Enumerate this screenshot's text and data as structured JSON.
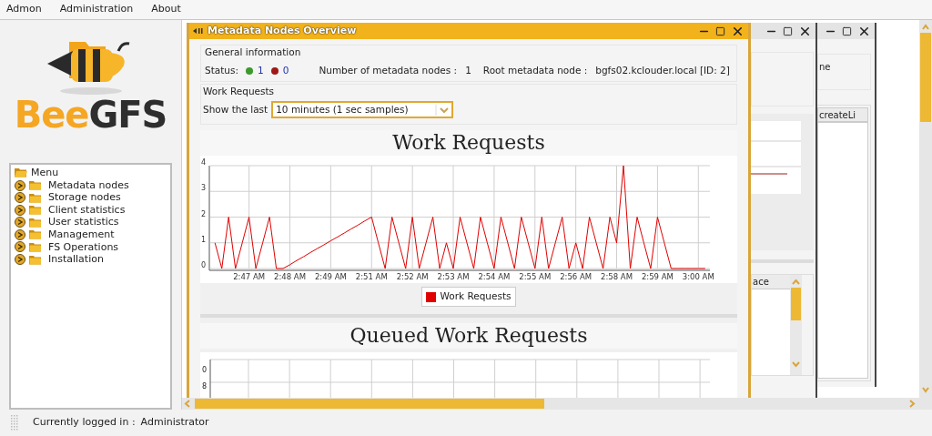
{
  "menu_bar": [
    "Admon",
    "Administration",
    "About"
  ],
  "logo": {
    "parts": [
      "Bee",
      "GFS"
    ]
  },
  "navigation_tree": {
    "label": "Menu",
    "expanded": true,
    "children": [
      {
        "label": "Metadata nodes",
        "expanded": false
      },
      {
        "label": "Storage nodes",
        "expanded": false
      },
      {
        "label": "Client statistics",
        "expanded": false
      },
      {
        "label": "User statistics",
        "expanded": false
      },
      {
        "label": "Management",
        "expanded": false
      },
      {
        "label": "FS Operations",
        "expanded": false
      },
      {
        "label": "Installation",
        "expanded": false
      }
    ]
  },
  "background_windows": [
    {
      "active": false,
      "label": "ne",
      "table_column": "createLi"
    },
    {
      "active": false,
      "table_column": "ace"
    }
  ],
  "main_window": {
    "title": "Metadata Nodes Overview",
    "active": true,
    "general_information": {
      "heading": "General information",
      "status_label": "Status:",
      "status_counts": [
        {
          "color": "#3c9a2c",
          "count": "1"
        },
        {
          "color": "#a01818",
          "count": "0"
        }
      ],
      "node_count_label": "Number of metadata nodes :",
      "node_count": "1",
      "root_label": "Root metadata node :",
      "root_value": "bgfs02.kclouder.local [ID: 2]"
    },
    "work_requests": {
      "heading": "Work Requests",
      "range_label": "Show the last",
      "range_value": "10 minutes (1 sec samples)"
    },
    "work_chart": {
      "title": "Work Requests",
      "chart_data": {
        "type": "line",
        "categories": [
          null,
          null,
          null,
          null,
          null,
          "2:47 AM",
          null,
          null,
          null,
          null,
          null,
          "2:48 AM",
          null,
          null,
          null,
          null,
          null,
          "2:49 AM",
          null,
          null,
          null,
          null,
          null,
          "2:51 AM",
          null,
          null,
          null,
          null,
          null,
          "2:52 AM",
          null,
          null,
          null,
          null,
          null,
          "2:53 AM",
          null,
          null,
          null,
          null,
          null,
          "2:54 AM",
          null,
          null,
          null,
          null,
          null,
          "2:55 AM",
          null,
          null,
          null,
          null,
          null,
          "2:56 AM",
          null,
          null,
          null,
          null,
          null,
          "2:58 AM",
          null,
          null,
          null,
          null,
          null,
          "2:59 AM",
          null,
          null,
          null,
          null,
          null,
          "3:00 AM",
          null
        ],
        "series": [
          {
            "name": "Work Requests",
            "color": "#e00000",
            "values": [
              1,
              0,
              2,
              0,
              1,
              2,
              0,
              1,
              2,
              0,
              0,
              0.15,
              0.31,
              0.46,
              0.62,
              0.77,
              0.92,
              1.08,
              1.23,
              1.38,
              1.54,
              1.69,
              1.85,
              2,
              1,
              0,
              2,
              1,
              0,
              2,
              0,
              1,
              2,
              0,
              1,
              0,
              2,
              1,
              0,
              2,
              1,
              0,
              2,
              1,
              0,
              2,
              1,
              0,
              2,
              0,
              1,
              2,
              0,
              1,
              0,
              2,
              1,
              0,
              2,
              1,
              4,
              0,
              2,
              1,
              0,
              2,
              1,
              0,
              0,
              0,
              0,
              0,
              0
            ]
          }
        ],
        "ylim": [
          0,
          4
        ],
        "grid": true,
        "yticks": [
          0,
          1,
          2,
          3,
          4
        ]
      }
    },
    "queued_chart": {
      "title": "Queued Work Requests",
      "y_tick_labels": [
        "0",
        "8"
      ]
    }
  },
  "status_bar": {
    "label": "Currently logged in :",
    "user": "Administrator"
  }
}
